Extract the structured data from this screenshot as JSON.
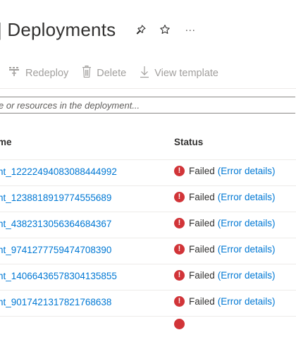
{
  "header": {
    "title": "| Deployments",
    "more_label": "···"
  },
  "toolbar": {
    "redeploy_label": "Redeploy",
    "delete_label": "Delete",
    "view_template_label": "View template"
  },
  "search": {
    "placeholder": "e or resources in the deployment..."
  },
  "table": {
    "columns": [
      "me",
      "Status"
    ],
    "rows": [
      {
        "name": "nt_12222494083088444992",
        "status": "Failed",
        "details": "(Error details)"
      },
      {
        "name": "nt_1238818919774555689",
        "status": "Failed",
        "details": "(Error details)"
      },
      {
        "name": "nt_4382313056364684367",
        "status": "Failed",
        "details": "(Error details)"
      },
      {
        "name": "nt_9741277759474708390",
        "status": "Failed",
        "details": "(Error details)"
      },
      {
        "name": "nt_14066436578304135855",
        "status": "Failed",
        "details": "(Error details)"
      },
      {
        "name": "nt_9017421317821768638",
        "status": "Failed",
        "details": "(Error details)"
      }
    ]
  },
  "colors": {
    "link": "#0078d4",
    "error": "#d13438",
    "disabled_text": "#a19f9d"
  },
  "icons": {
    "pin": "pin-icon",
    "star": "star-icon",
    "more": "more-icon",
    "redeploy": "redeploy-icon",
    "delete": "trash-icon",
    "view_template": "download-icon",
    "error": "error-circle-icon"
  }
}
